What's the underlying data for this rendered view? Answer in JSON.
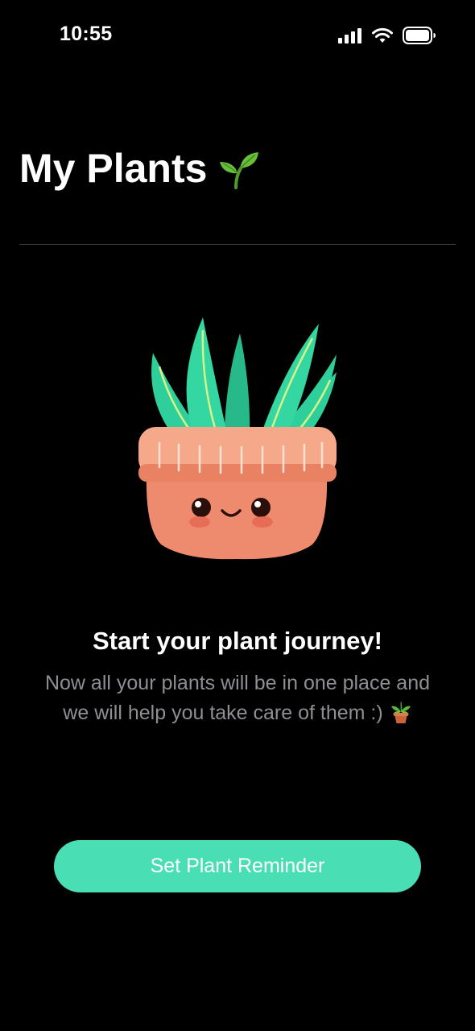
{
  "status_bar": {
    "time": "10:55",
    "icons": [
      "signal-icon",
      "wifi-icon",
      "battery-icon"
    ]
  },
  "header": {
    "title": "My Plants",
    "title_icon": "sprout-icon"
  },
  "empty_state": {
    "illustration": "smiling-potted-plant",
    "title": "Start your plant journey!",
    "body_line_1": "Now all your plants will be in one place and",
    "body_line_2": "we will help you take care of them :)",
    "body_icon": "potted-plant-icon"
  },
  "cta": {
    "label": "Set Plant Reminder"
  },
  "colors": {
    "background": "#000000",
    "accent": "#4adeb5",
    "secondary_text": "#8e8e93",
    "pot": "#ee8a6d",
    "leaves": "#2fcf9c"
  }
}
